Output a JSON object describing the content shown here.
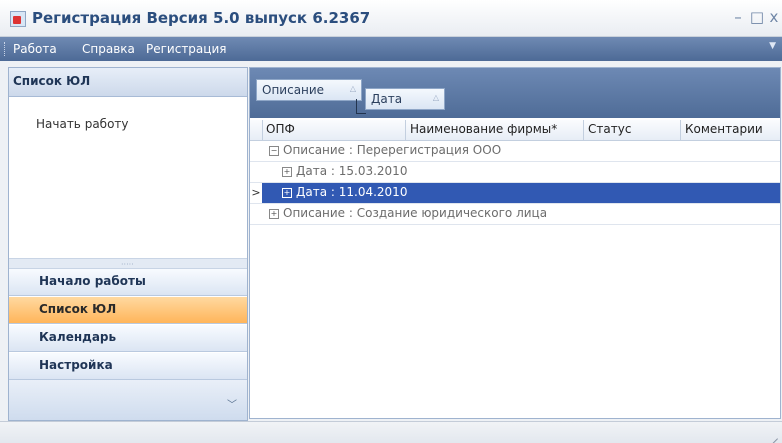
{
  "window": {
    "title": "Регистрация Версия 5.0 выпуск 6.2367",
    "minimize": "–",
    "maximize": "□",
    "close": "x"
  },
  "menubar": {
    "items": [
      "Работа",
      "Справка",
      "Регистрация"
    ]
  },
  "left_pane": {
    "header": "Список ЮЛ",
    "link": "Начать работу",
    "nav": [
      "Начало работы",
      "Список ЮЛ",
      "Календарь",
      "Настройка"
    ],
    "active_nav": "Список ЮЛ"
  },
  "grid": {
    "group_by": [
      "Описание",
      "Дата"
    ],
    "columns": [
      "ОПФ",
      "Наименование фирмы*",
      "Статус",
      "Коментарии"
    ],
    "rows": [
      {
        "text": "Описание : Перерегистрация ООО",
        "expanded": true,
        "selected": false
      },
      {
        "text": "Дата : 15.03.2010",
        "expanded": false,
        "selected": false
      },
      {
        "text": "Дата : 11.04.2010",
        "expanded": false,
        "selected": true
      },
      {
        "text": "Описание : Создание юридического лица",
        "expanded": false,
        "selected": false
      }
    ],
    "plus": "+",
    "minus": "−",
    "current_row": ">"
  },
  "colors": {
    "accent": "#4d6a96",
    "selection": "#3159b3",
    "active_nav": "#ffb55a"
  }
}
